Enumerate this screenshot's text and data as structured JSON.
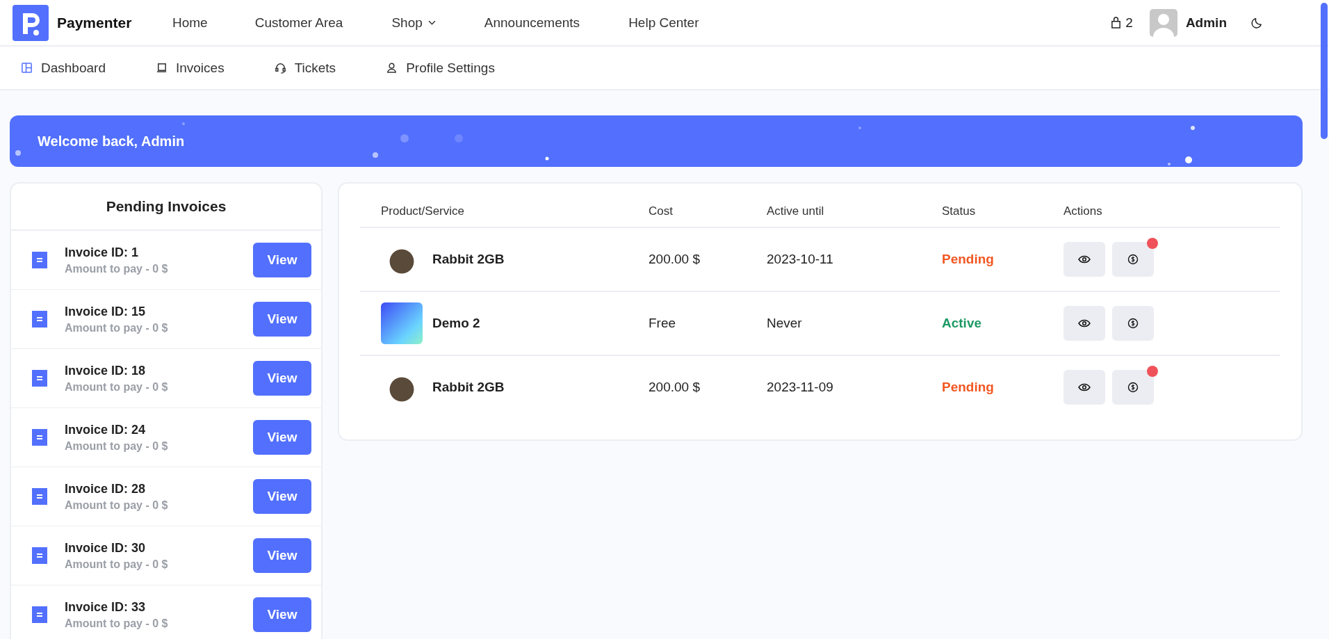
{
  "brand": {
    "name": "Paymenter"
  },
  "top_nav": [
    {
      "label": "Home",
      "dropdown": false
    },
    {
      "label": "Customer Area",
      "dropdown": false
    },
    {
      "label": "Shop",
      "dropdown": true
    },
    {
      "label": "Announcements",
      "dropdown": false
    },
    {
      "label": "Help Center",
      "dropdown": false
    }
  ],
  "cart": {
    "count": "2"
  },
  "user": {
    "name": "Admin"
  },
  "sub_nav": [
    {
      "label": "Dashboard",
      "selected": true
    },
    {
      "label": "Invoices",
      "selected": false
    },
    {
      "label": "Tickets",
      "selected": false
    },
    {
      "label": "Profile Settings",
      "selected": false
    }
  ],
  "banner": {
    "text": "Welcome back, Admin"
  },
  "pending_invoices": {
    "title": "Pending Invoices",
    "items": [
      {
        "title": "Invoice ID: 1",
        "amount": "Amount to pay - 0 $",
        "button": "View"
      },
      {
        "title": "Invoice ID: 15",
        "amount": "Amount to pay - 0 $",
        "button": "View"
      },
      {
        "title": "Invoice ID: 18",
        "amount": "Amount to pay - 0 $",
        "button": "View"
      },
      {
        "title": "Invoice ID: 24",
        "amount": "Amount to pay - 0 $",
        "button": "View"
      },
      {
        "title": "Invoice ID: 28",
        "amount": "Amount to pay - 0 $",
        "button": "View"
      },
      {
        "title": "Invoice ID: 30",
        "amount": "Amount to pay - 0 $",
        "button": "View"
      },
      {
        "title": "Invoice ID: 33",
        "amount": "Amount to pay - 0 $",
        "button": "View"
      }
    ]
  },
  "services": {
    "columns": [
      "Product/Service",
      "Cost",
      "Active until",
      "Status",
      "Actions"
    ],
    "rows": [
      {
        "kind": "animal",
        "name": "Rabbit 2GB",
        "cost": "200.00 $",
        "active_until": "2023-10-11",
        "status": "Pending",
        "color": "#f25822",
        "payment_due": true
      },
      {
        "kind": "logo",
        "name": "Demo 2",
        "cost": "Free",
        "active_until": "Never",
        "status": "Active",
        "color": "#1e9964",
        "payment_due": false
      },
      {
        "kind": "animal",
        "name": "Rabbit 2GB",
        "cost": "200.00 $",
        "active_until": "2023-11-09",
        "status": "Pending",
        "color": "#f25822",
        "payment_due": true
      }
    ]
  }
}
